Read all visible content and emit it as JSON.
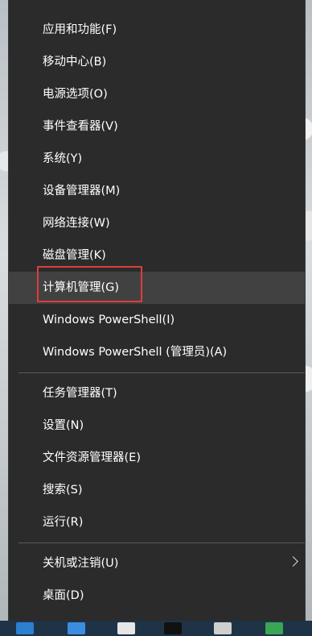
{
  "menu": {
    "items": [
      {
        "label": "应用和功能(F)"
      },
      {
        "label": "移动中心(B)"
      },
      {
        "label": "电源选项(O)"
      },
      {
        "label": "事件查看器(V)"
      },
      {
        "label": "系统(Y)"
      },
      {
        "label": "设备管理器(M)"
      },
      {
        "label": "网络连接(W)"
      },
      {
        "label": "磁盘管理(K)"
      },
      {
        "label": "计算机管理(G)",
        "highlighted": true
      },
      {
        "label": "Windows PowerShell(I)"
      },
      {
        "label": "Windows PowerShell (管理员)(A)"
      },
      {
        "label": "任务管理器(T)"
      },
      {
        "label": "设置(N)"
      },
      {
        "label": "文件资源管理器(E)"
      },
      {
        "label": "搜索(S)"
      },
      {
        "label": "运行(R)"
      },
      {
        "label": "关机或注销(U)",
        "submenu": true
      },
      {
        "label": "桌面(D)"
      }
    ]
  },
  "colors": {
    "menu_bg": "#2b2b2b",
    "hover_bg": "#414141",
    "highlight_border": "#e03c3c",
    "text": "#ffffff",
    "taskbar": "#1f3347"
  },
  "icons": {
    "submenu": "chevron-right-icon"
  }
}
